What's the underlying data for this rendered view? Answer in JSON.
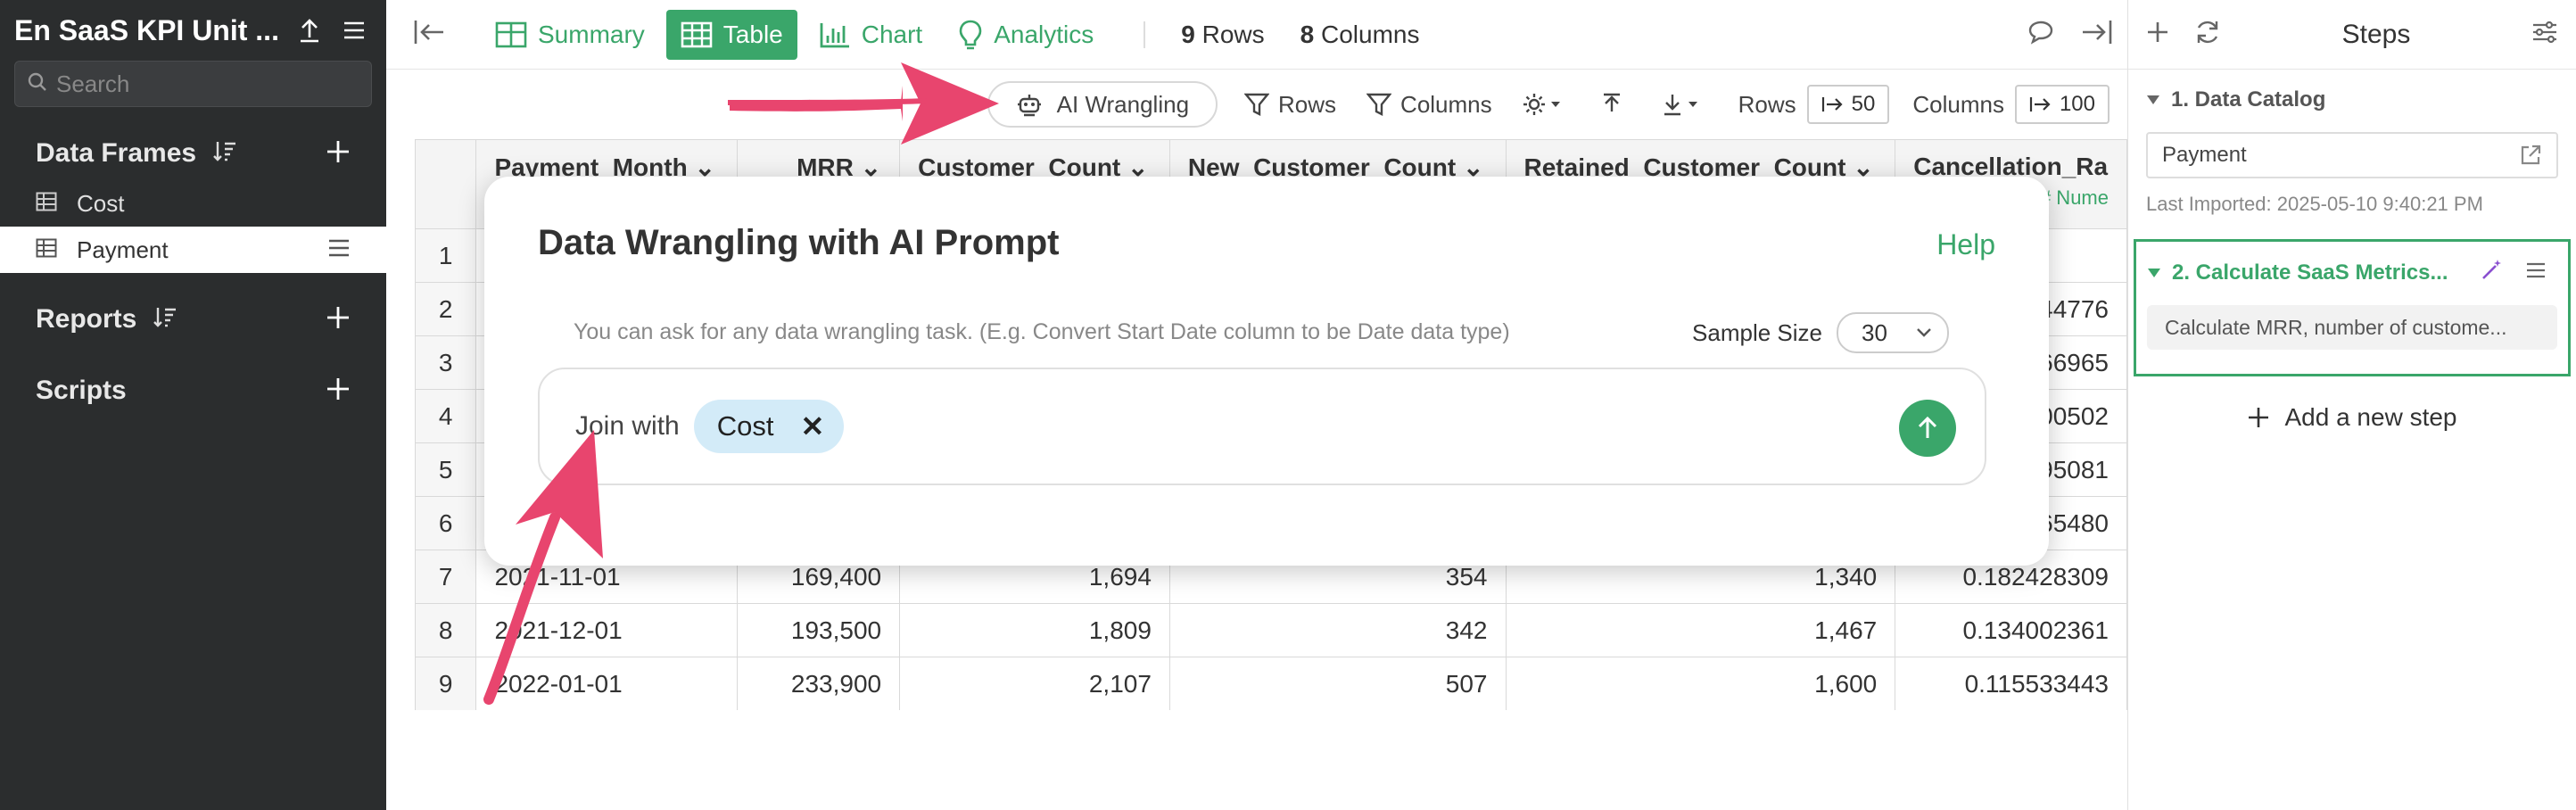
{
  "sidebar": {
    "title": "En SaaS KPI Unit ...",
    "search_placeholder": "Search",
    "data_frames_label": "Data Frames",
    "data_frames": [
      {
        "label": "Cost"
      },
      {
        "label": "Payment"
      }
    ],
    "reports_label": "Reports",
    "scripts_label": "Scripts"
  },
  "toolbar": {
    "summary": "Summary",
    "table": "Table",
    "chart": "Chart",
    "analytics": "Analytics",
    "rows_count": "9",
    "rows_label": "Rows",
    "cols_count": "8",
    "cols_label": "Columns"
  },
  "subbar": {
    "ai_wrangling": "AI Wrangling",
    "rows_filter": "Rows",
    "columns_filter": "Columns",
    "rows_limit_label": "Rows",
    "rows_limit": "50",
    "cols_limit_label": "Columns",
    "cols_limit": "100"
  },
  "table": {
    "headers": [
      "Payment_Month",
      "MRR",
      "Customer_Count",
      "New_Customer_Count",
      "Retained_Customer_Count",
      "Cancellation_Ra"
    ],
    "last_col_type": "# Nume",
    "rows": [
      {
        "n": "1",
        "c": [
          "",
          "",
          "",
          "",
          "",
          ""
        ]
      },
      {
        "n": "2",
        "c": [
          "",
          "",
          "",
          "",
          "",
          "044776"
        ]
      },
      {
        "n": "3",
        "c": [
          "",
          "",
          "",
          "",
          "",
          "466965"
        ]
      },
      {
        "n": "4",
        "c": [
          "",
          "",
          "",
          "",
          "",
          "100502"
        ]
      },
      {
        "n": "5",
        "c": [
          "",
          "",
          "",
          "",
          "",
          "295081"
        ]
      },
      {
        "n": "6",
        "c": [
          "",
          "",
          "",
          "",
          "",
          "765480"
        ]
      },
      {
        "n": "7",
        "c": [
          "2021-11-01",
          "169,400",
          "1,694",
          "354",
          "1,340",
          "0.182428309"
        ]
      },
      {
        "n": "8",
        "c": [
          "2021-12-01",
          "193,500",
          "1,809",
          "342",
          "1,467",
          "0.134002361"
        ]
      },
      {
        "n": "9",
        "c": [
          "2022-01-01",
          "233,900",
          "2,107",
          "507",
          "1,600",
          "0.115533443"
        ]
      }
    ]
  },
  "modal": {
    "title": "Data Wrangling with AI Prompt",
    "help": "Help",
    "hint": "You can ask for any data wrangling task. (E.g. Convert Start Date column to be Date data type)",
    "sample_label": "Sample Size",
    "sample_value": "30",
    "prompt_text": "Join with",
    "chip_label": "Cost"
  },
  "steps": {
    "title": "Steps",
    "step1_label": "1. Data Catalog",
    "step1_input": "Payment",
    "step1_imported": "Last Imported: 2025-05-10 9:40:21 PM",
    "step2_label": "2. Calculate SaaS Metrics...",
    "step2_desc": "Calculate MRR, number of custome...",
    "add_step": "Add a new step"
  },
  "colors": {
    "accent": "#3aa66a",
    "arrow": "#e8456e",
    "sidebar_bg": "#2b2d2e",
    "chip_bg": "#d3ebf8"
  }
}
